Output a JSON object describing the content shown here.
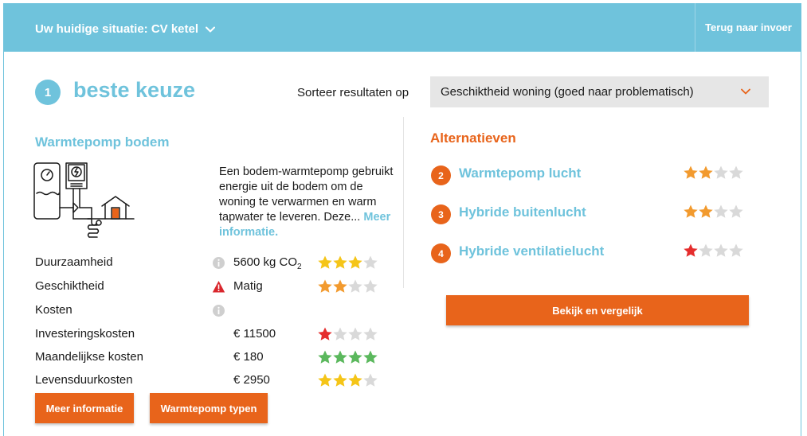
{
  "header": {
    "situation_label": "Uw huidige situatie: CV ketel",
    "back_label": "Terug naar invoer"
  },
  "best": {
    "rank": "1",
    "title": "beste keuze",
    "product_name": "Warmtepomp bodem",
    "description": "Een bodem-warmtepomp gebruikt energie uit de bodem om de woning te verwarmen en warm tapwater te leveren. Deze...",
    "more_link": "Meer informatie."
  },
  "sort": {
    "label": "Sorteer resultaten op",
    "selected": "Geschiktheid woning (goed naar problematisch)"
  },
  "properties": [
    {
      "label": "Duurzaamheid",
      "icon": "info-icon",
      "value": "5600 kg CO",
      "value_sub": "2",
      "stars": 3,
      "star_color": "#f5c518"
    },
    {
      "label": "Geschiktheid",
      "icon": "warning-icon",
      "value": "Matig",
      "value_sub": "",
      "stars": 2,
      "star_color": "#f29a2e"
    },
    {
      "label": "Kosten",
      "icon": "info-icon",
      "value": "",
      "value_sub": "",
      "stars": 0,
      "star_color": ""
    },
    {
      "label": "Investeringskosten",
      "icon": "",
      "value": "€ 11500",
      "value_sub": "",
      "stars": 1,
      "star_color": "#e52d2d"
    },
    {
      "label": "Maandelijkse kosten",
      "icon": "",
      "value": "€ 180",
      "value_sub": "",
      "stars": 4,
      "star_color": "#5bb85d"
    },
    {
      "label": "Levensduurkosten",
      "icon": "",
      "value": "€ 2950",
      "value_sub": "",
      "stars": 3,
      "star_color": "#f5c518"
    }
  ],
  "buttons": {
    "more_info": "Meer informatie",
    "types": "Warmtepomp typen",
    "compare": "Bekijk en vergelijk"
  },
  "alternatives": {
    "heading": "Alternatieven",
    "items": [
      {
        "rank": "2",
        "name": "Warmtepomp lucht",
        "stars": 2,
        "star_color": "#f29a2e"
      },
      {
        "rank": "3",
        "name": "Hybride buitenlucht",
        "stars": 2,
        "star_color": "#f29a2e"
      },
      {
        "rank": "4",
        "name": "Hybride ventilatielucht",
        "stars": 1,
        "star_color": "#e52d2d"
      }
    ]
  },
  "colors": {
    "accent_blue": "#6fc3dc",
    "accent_orange": "#e8641b",
    "star_empty": "#d9d9d9"
  }
}
